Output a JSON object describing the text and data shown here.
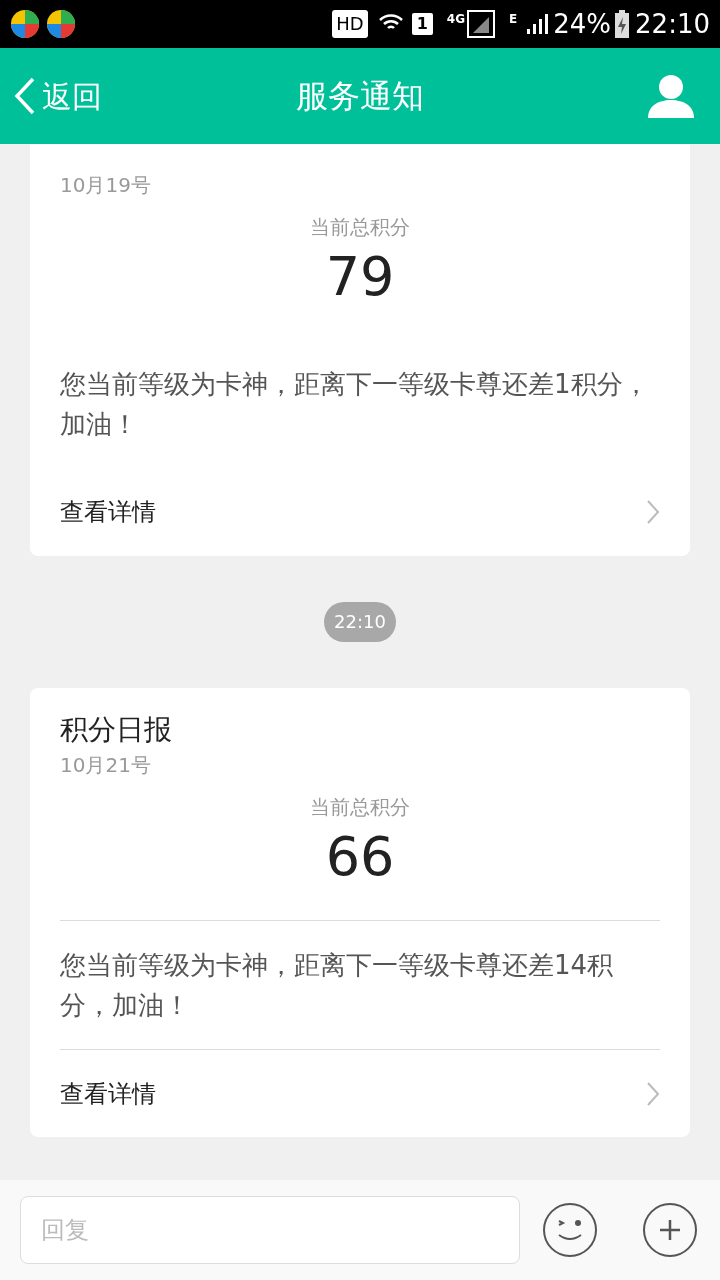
{
  "status_bar": {
    "hd": "HD",
    "sim": "1",
    "network": "4G",
    "network_2": "E",
    "battery": "24%",
    "time": "22:10"
  },
  "header": {
    "back": "返回",
    "title": "服务通知"
  },
  "messages": [
    {
      "date": "10月19号",
      "label": "当前总积分",
      "points": "79",
      "text": "您当前等级为卡神，距离下一等级卡尊还差1积分，加油！",
      "link": "查看详情",
      "dividers": false
    },
    {
      "timestamp": "22:10",
      "title": "积分日报",
      "date": "10月21号",
      "label": "当前总积分",
      "points": "66",
      "text": "您当前等级为卡神，距离下一等级卡尊还差14积分，加油！",
      "link": "查看详情",
      "dividers": true
    }
  ],
  "reply": {
    "placeholder": "回复"
  }
}
